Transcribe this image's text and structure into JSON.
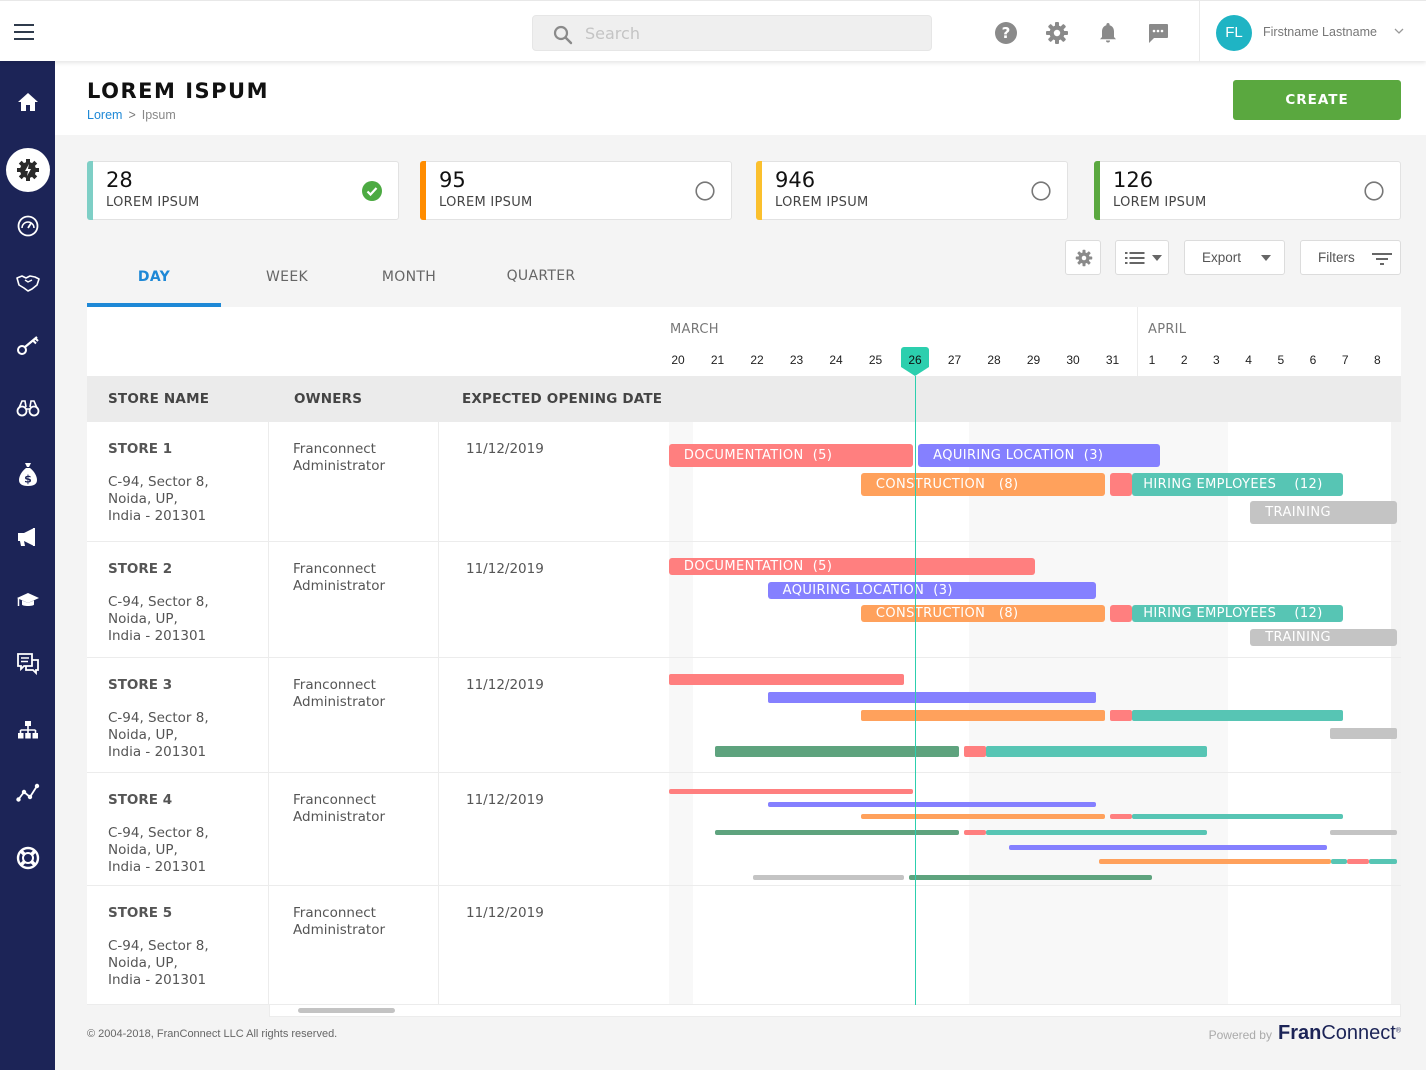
{
  "topbar": {
    "search_placeholder": "Search",
    "icons": [
      "help-icon",
      "settings-icon",
      "bell-icon",
      "chat-icon"
    ],
    "user": {
      "initials": "FL",
      "name": "Firstname Lastname"
    }
  },
  "sidebar": {
    "items": [
      {
        "icon": "home-icon",
        "active": false
      },
      {
        "icon": "gear-bolt-icon",
        "active": true
      },
      {
        "icon": "speedometer-icon",
        "active": false
      },
      {
        "icon": "handshake-icon",
        "active": false
      },
      {
        "icon": "key-icon",
        "active": false
      },
      {
        "icon": "binoculars-icon",
        "active": false
      },
      {
        "icon": "money-bag-icon",
        "active": false
      },
      {
        "icon": "megaphone-icon",
        "active": false
      },
      {
        "icon": "graduation-cap-icon",
        "active": false
      },
      {
        "icon": "feedback-icon",
        "active": false
      },
      {
        "icon": "org-chart-icon",
        "active": false
      },
      {
        "icon": "trend-line-icon",
        "active": false
      },
      {
        "icon": "lifebuoy-icon",
        "active": false
      }
    ]
  },
  "header": {
    "title": "LOREM ISPUM",
    "breadcrumb": [
      {
        "label": "Lorem",
        "link": true
      },
      {
        "label": "Ipsum",
        "link": false
      }
    ],
    "breadcrumb_sep": ">",
    "create_label": "CREATE"
  },
  "kpis": [
    {
      "value": "28",
      "label": "LOREM IPSUM",
      "color": "#7ecfc6",
      "checked": true
    },
    {
      "value": "95",
      "label": "LOREM IPSUM",
      "color": "#ff8c00",
      "checked": false
    },
    {
      "value": "946",
      "label": "LOREM IPSUM",
      "color": "#fbc02d",
      "checked": false
    },
    {
      "value": "126",
      "label": "LOREM IPSUM",
      "color": "#5aa83f",
      "checked": false
    }
  ],
  "toolbar": {
    "export_label": "Export",
    "filters_label": "Filters"
  },
  "tabs": [
    {
      "label": "DAY",
      "active": true
    },
    {
      "label": "WEEK",
      "active": false
    },
    {
      "label": "MONTH",
      "active": false
    },
    {
      "label": "QUARTER",
      "active": false
    }
  ],
  "timeline": {
    "months": [
      {
        "label": "MARCH",
        "days": [
          20,
          21,
          22,
          23,
          24,
          25,
          26,
          27,
          28,
          29,
          30,
          31
        ]
      },
      {
        "label": "APRIL",
        "days": [
          1,
          2,
          3,
          4,
          5,
          6,
          7,
          8
        ]
      }
    ],
    "today": {
      "month": "MARCH",
      "day": 26
    }
  },
  "columns": {
    "store": "STORE NAME",
    "owners": "OWNERS",
    "date": "EXPECTED OPENING DATE"
  },
  "colors": {
    "documentation": "#ff7f7f",
    "aquiring": "#8580ff",
    "construction": "#ffa15c",
    "hiring": "#57c5b4",
    "training": "#c4c4c4",
    "green": "#5ea37e",
    "today": "#2ccfae"
  },
  "stores": [
    {
      "name": "STORE 1",
      "address": "C-94, Sector 8,\nNoida, UP,\nIndia - 201301",
      "owner": "Franconnect\nAdministrator",
      "date": "11/12/2019",
      "bars": [
        {
          "type": "documentation",
          "label": "DOCUMENTATION  (5)",
          "start": -0.23,
          "end": 5.96,
          "lane": 0,
          "thick": "full"
        },
        {
          "type": "aquiring",
          "label": "AQUIRING LOCATION  (3)",
          "start": 6.08,
          "end": 12.25,
          "lane": 0,
          "thick": "full"
        },
        {
          "type": "construction",
          "label": "CONSTRUCTION   (8)",
          "start": 4.63,
          "end": 10.82,
          "lane": 1,
          "thick": "full"
        },
        {
          "type": "documentation",
          "label": "",
          "start": 10.94,
          "end": 11.5,
          "lane": 1,
          "thick": "full"
        },
        {
          "type": "hiring",
          "label": "HIRING EMPLOYEES    (12)",
          "start": 11.5,
          "end": 17.93,
          "lane": 1,
          "thick": "full"
        },
        {
          "type": "training",
          "label": "TRAINING",
          "start": 15.05,
          "end": 19.6,
          "lane": 2,
          "thick": "full"
        }
      ]
    },
    {
      "name": "STORE 2",
      "address": "C-94, Sector 8,\nNoida, UP,\nIndia - 201301",
      "owner": "Franconnect\nAdministrator",
      "date": "11/12/2019",
      "bars": [
        {
          "type": "documentation",
          "label": "DOCUMENTATION  (5)",
          "start": -0.23,
          "end": 9.05,
          "lane": 0,
          "thick": "mid"
        },
        {
          "type": "aquiring",
          "label": "AQUIRING LOCATION  (3)",
          "start": 2.27,
          "end": 10.57,
          "lane": 1,
          "thick": "mid"
        },
        {
          "type": "construction",
          "label": "CONSTRUCTION   (8)",
          "start": 4.63,
          "end": 10.82,
          "lane": 2,
          "thick": "mid"
        },
        {
          "type": "documentation",
          "label": "",
          "start": 10.94,
          "end": 11.5,
          "lane": 2,
          "thick": "mid"
        },
        {
          "type": "hiring",
          "label": "HIRING EMPLOYEES    (12)",
          "start": 11.5,
          "end": 17.93,
          "lane": 2,
          "thick": "mid"
        },
        {
          "type": "training",
          "label": "TRAINING",
          "start": 15.05,
          "end": 19.6,
          "lane": 3,
          "thick": "mid"
        }
      ]
    },
    {
      "name": "STORE 3",
      "address": "C-94, Sector 8,\nNoida, UP,\nIndia - 201301",
      "owner": "Franconnect\nAdministrator",
      "date": "11/12/2019",
      "bars": [
        {
          "type": "documentation",
          "label": "",
          "start": -0.23,
          "end": 5.71,
          "lane": 0,
          "thick": "thin"
        },
        {
          "type": "aquiring",
          "label": "",
          "start": 2.27,
          "end": 10.57,
          "lane": 1,
          "thick": "thin"
        },
        {
          "type": "construction",
          "label": "",
          "start": 4.63,
          "end": 10.82,
          "lane": 2,
          "thick": "thin"
        },
        {
          "type": "documentation",
          "label": "",
          "start": 10.94,
          "end": 11.5,
          "lane": 2,
          "thick": "thin"
        },
        {
          "type": "hiring",
          "label": "",
          "start": 11.5,
          "end": 17.93,
          "lane": 2,
          "thick": "thin"
        },
        {
          "type": "training",
          "label": "",
          "start": 17.54,
          "end": 19.6,
          "lane": 3,
          "thick": "thin"
        },
        {
          "type": "green",
          "label": "",
          "start": 0.94,
          "end": 7.12,
          "lane": 4,
          "thick": "thin"
        },
        {
          "type": "documentation",
          "label": "",
          "start": 7.25,
          "end": 7.81,
          "lane": 4,
          "thick": "thin"
        },
        {
          "type": "hiring",
          "label": "",
          "start": 7.81,
          "end": 13.7,
          "lane": 4,
          "thick": "thin"
        }
      ]
    },
    {
      "name": "STORE 4",
      "address": "C-94, Sector 8,\nNoida, UP,\nIndia - 201301",
      "owner": "Franconnect\nAdministrator",
      "date": "11/12/2019",
      "bars": [
        {
          "type": "documentation",
          "label": "",
          "start": -0.23,
          "end": 5.96,
          "lane": 0,
          "thick": "line"
        },
        {
          "type": "aquiring",
          "label": "",
          "start": 2.27,
          "end": 10.57,
          "lane": 1,
          "thick": "line"
        },
        {
          "type": "construction",
          "label": "",
          "start": 4.63,
          "end": 10.82,
          "lane": 2,
          "thick": "line"
        },
        {
          "type": "documentation",
          "label": "",
          "start": 10.94,
          "end": 11.5,
          "lane": 2,
          "thick": "line"
        },
        {
          "type": "hiring",
          "label": "",
          "start": 11.5,
          "end": 17.93,
          "lane": 2,
          "thick": "line"
        },
        {
          "type": "training",
          "label": "",
          "start": 17.54,
          "end": 19.6,
          "lane": 3,
          "thick": "line"
        },
        {
          "type": "green",
          "label": "",
          "start": 0.94,
          "end": 7.12,
          "lane": 3,
          "thick": "line"
        },
        {
          "type": "documentation",
          "label": "",
          "start": 7.25,
          "end": 7.81,
          "lane": 3,
          "thick": "line"
        },
        {
          "type": "hiring",
          "label": "",
          "start": 7.81,
          "end": 13.7,
          "lane": 3,
          "thick": "line"
        },
        {
          "type": "aquiring",
          "label": "",
          "start": 8.37,
          "end": 17.44,
          "lane": 4,
          "thick": "line"
        },
        {
          "type": "construction",
          "label": "",
          "start": 10.66,
          "end": 17.55,
          "lane": 5,
          "thick": "line"
        },
        {
          "type": "hiring",
          "label": "",
          "start": 17.55,
          "end": 18.05,
          "lane": 5,
          "thick": "line"
        },
        {
          "type": "documentation",
          "label": "",
          "start": 18.05,
          "end": 18.75,
          "lane": 5,
          "thick": "line"
        },
        {
          "type": "hiring",
          "label": "",
          "start": 18.75,
          "end": 19.6,
          "lane": 5,
          "thick": "line"
        },
        {
          "type": "training",
          "label": "",
          "start": 1.91,
          "end": 5.71,
          "lane": 6,
          "thick": "line"
        },
        {
          "type": "green",
          "label": "",
          "start": 5.84,
          "end": 12.01,
          "lane": 6,
          "thick": "line"
        }
      ]
    },
    {
      "name": "STORE 5",
      "address": "C-94, Sector 8,\nNoida, UP,\nIndia - 201301",
      "owner": "Franconnect\nAdministrator",
      "date": "11/12/2019",
      "bars": []
    }
  ],
  "footer": {
    "copyright": "© 2004-2018, FranConnect LLC All rights reserved.",
    "powered_by": "Powered by",
    "brand_bold": "Fran",
    "brand_rest": "Connect",
    "brand_mark": "®"
  }
}
